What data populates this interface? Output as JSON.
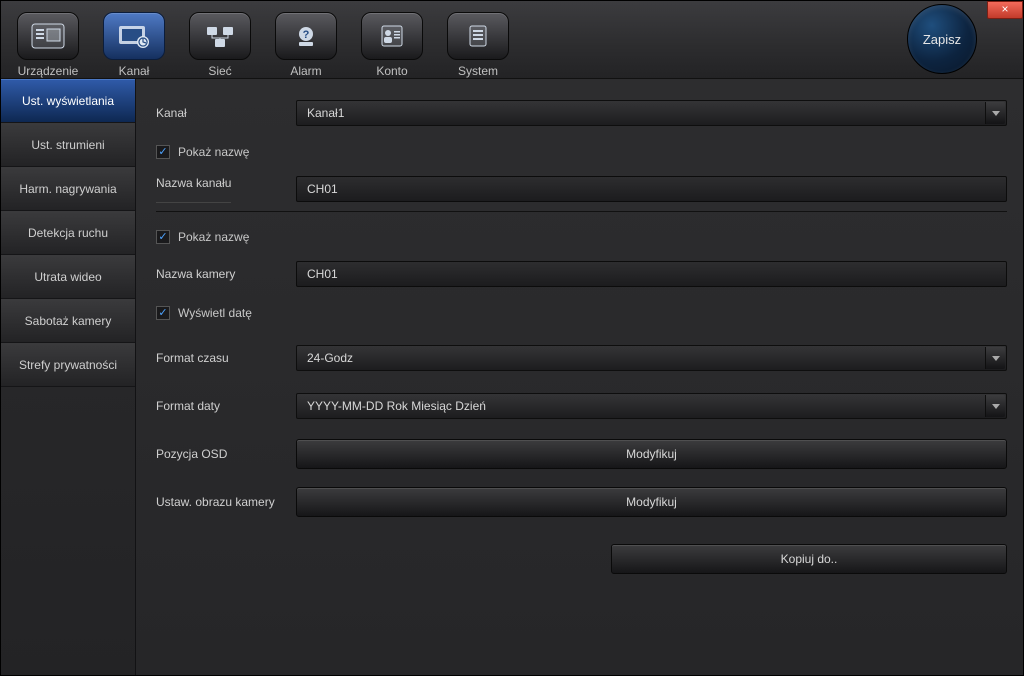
{
  "window": {
    "close_symbol": "×"
  },
  "topbar": {
    "items": [
      {
        "label": "Urządzenie"
      },
      {
        "label": "Kanał"
      },
      {
        "label": "Sieć"
      },
      {
        "label": "Alarm"
      },
      {
        "label": "Konto"
      },
      {
        "label": "System"
      }
    ],
    "save_label": "Zapisz"
  },
  "sidebar": {
    "items": [
      {
        "label": "Ust. wyświetlania"
      },
      {
        "label": "Ust. strumieni"
      },
      {
        "label": "Harm. nagrywania"
      },
      {
        "label": "Detekcja ruchu"
      },
      {
        "label": "Utrata wideo"
      },
      {
        "label": "Sabotaż kamery"
      },
      {
        "label": "Strefy prywatności"
      }
    ]
  },
  "form": {
    "channel_label": "Kanał",
    "channel_value": "Kanał1",
    "show_name1_label": "Pokaż nazwę",
    "show_name1_checked": true,
    "channel_name_label": "Nazwa kanału",
    "channel_name_value": "CH01",
    "show_name2_label": "Pokaż nazwę",
    "show_name2_checked": true,
    "camera_name_label": "Nazwa kamery",
    "camera_name_value": "CH01",
    "show_date_label": "Wyświetl datę",
    "show_date_checked": true,
    "time_format_label": "Format czasu",
    "time_format_value": "24-Godz",
    "date_format_label": "Format daty",
    "date_format_value": "YYYY-MM-DD Rok Miesiąc Dzień",
    "osd_position_label": "Pozycja OSD",
    "osd_position_button": "Modyfikuj",
    "image_settings_label": "Ustaw. obrazu kamery",
    "image_settings_button": "Modyfikuj",
    "copy_to_button": "Kopiuj do.."
  }
}
